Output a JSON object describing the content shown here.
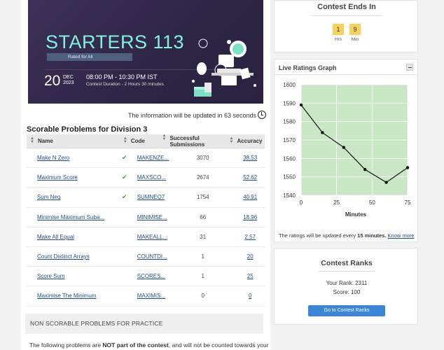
{
  "banner": {
    "title": "STARTERS 113",
    "rated": "Rated for All",
    "day": "20",
    "month": "DEC",
    "year": "2023",
    "time": "08:00 PM - 10:30 PM IST",
    "duration": "Contest Duration - 2  Hours 30 minutes"
  },
  "update_note": "The information will be updated in 63 seconds",
  "section_title": "Scorable Problems for Division 3",
  "table": {
    "headers": [
      "Name",
      "Code",
      "Successful Submissions",
      "Accuracy"
    ],
    "rows": [
      {
        "name": "Make N Zero",
        "solved": true,
        "code": "MAKENZE...",
        "subs": "3070",
        "acc": "38.53"
      },
      {
        "name": "Maximum Score",
        "solved": true,
        "code": "MAXSCO...",
        "subs": "2674",
        "acc": "52.62"
      },
      {
        "name": "Sum Neq",
        "solved": true,
        "code": "SUMNEQ7",
        "subs": "1754",
        "acc": "40.91"
      },
      {
        "name": "Minimise Maximum Suba...",
        "solved": false,
        "code": "MINIMISE...",
        "subs": "66",
        "acc": "18.96"
      },
      {
        "name": "Make All Equal",
        "solved": false,
        "code": "MAKEALL...",
        "subs": "31",
        "acc": "2.57"
      },
      {
        "name": "Count Distinct Arrays",
        "solved": false,
        "code": "COUNTDI...",
        "subs": "1",
        "acc": "20"
      },
      {
        "name": "Score Sum",
        "solved": false,
        "code": "SCORES...",
        "subs": "1",
        "acc": "25"
      },
      {
        "name": "Maximise The Minimum",
        "solved": false,
        "code": "MAXIMIS...",
        "subs": "0",
        "acc": "0"
      }
    ]
  },
  "non_scorable": "NON SCORABLE PROBLEMS FOR PRACTICE",
  "footnote": {
    "pre": "The following problems are ",
    "bold": "NOT part of the contest",
    "post": ", and will not be counted towards your"
  },
  "contest_ends": {
    "title": "Contest Ends In",
    "hrs": "1",
    "min": "9",
    "hrs_label": "Hrs",
    "min_label": "Min"
  },
  "ratings_graph": {
    "title": "Live Ratings Graph",
    "note_pre": "The ratings will be updated every ",
    "note_bold": "15 minutes.",
    "note_link": "Know more"
  },
  "chart_data": {
    "type": "line",
    "x": [
      0,
      15,
      30,
      45,
      60,
      75
    ],
    "y": [
      1589,
      1574,
      1566,
      1554,
      1547,
      1555
    ],
    "xlabel": "Minutes",
    "ylabel": "",
    "xlim": [
      0,
      75
    ],
    "ylim": [
      1540,
      1600
    ],
    "xticks": [
      "0",
      "25",
      "50",
      "75"
    ],
    "yticks": [
      "1540",
      "1550",
      "1560",
      "1570",
      "1580",
      "1590",
      "1600"
    ],
    "fill_color": "#c9e6c5",
    "line_color": "#111111"
  },
  "ranks": {
    "title": "Contest Ranks",
    "your_rank": "Your Rank: 2311",
    "score": "Score: 100",
    "button": "Go to Contest Ranks"
  }
}
